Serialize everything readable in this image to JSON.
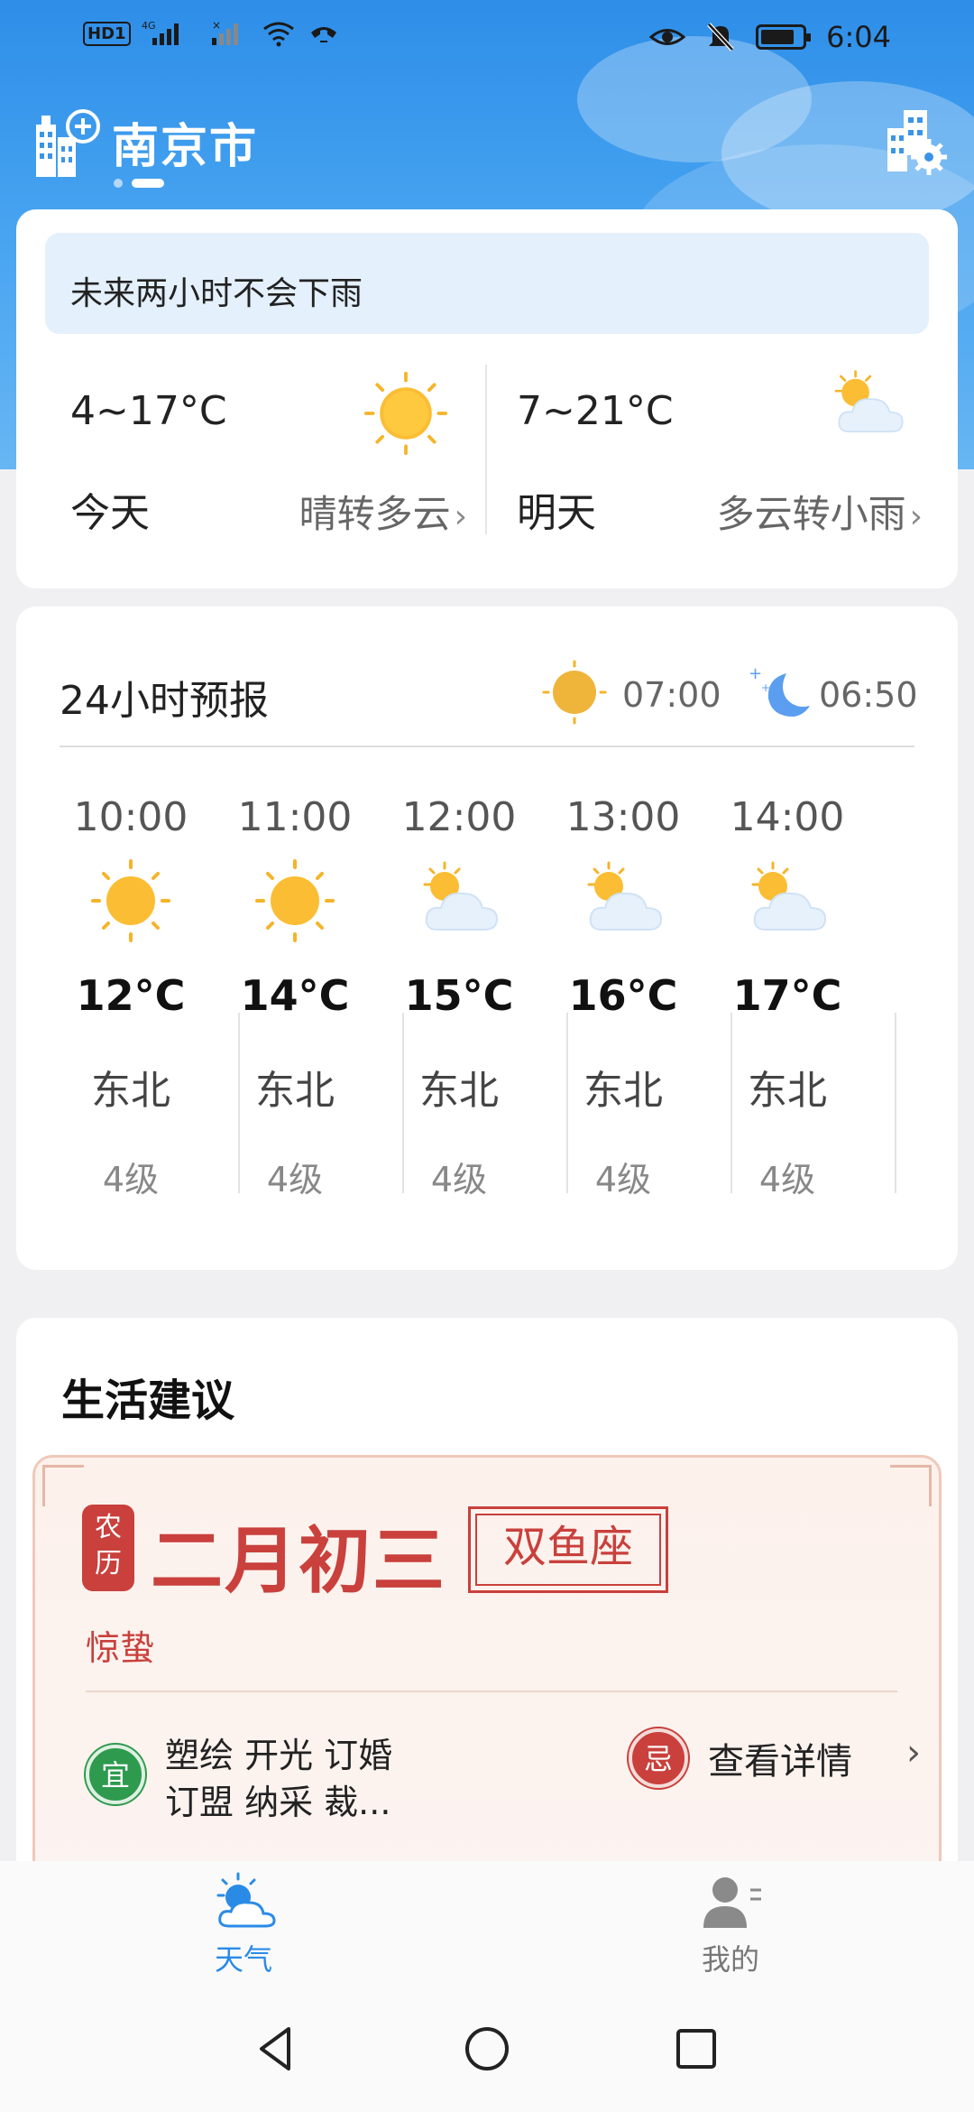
{
  "status_bar": {
    "network_label": "HD",
    "sim_label": "1",
    "signal_1_label": "4G",
    "time": "6:04"
  },
  "header": {
    "city": "南京市"
  },
  "nowcast": {
    "message": "未来两小时不会下雨"
  },
  "daily": [
    {
      "label": "今天",
      "range": "4~17°C",
      "condition": "晴转多云",
      "icon": "sun-icon"
    },
    {
      "label": "明天",
      "range": "7~21°C",
      "condition": "多云转小雨",
      "icon": "partly-cloudy-icon"
    }
  ],
  "hourly": {
    "title": "24小时预报",
    "sunrise": "07:00",
    "sunset": "06:50",
    "items": [
      {
        "time": "10:00",
        "icon": "sun-icon",
        "temp": "12°C",
        "wind_dir": "东北",
        "wind_level": "4级"
      },
      {
        "time": "11:00",
        "icon": "sun-icon",
        "temp": "14°C",
        "wind_dir": "东北",
        "wind_level": "4级"
      },
      {
        "time": "12:00",
        "icon": "partly-cloudy-icon",
        "temp": "15°C",
        "wind_dir": "东北",
        "wind_level": "4级"
      },
      {
        "time": "13:00",
        "icon": "partly-cloudy-icon",
        "temp": "16°C",
        "wind_dir": "东北",
        "wind_level": "4级"
      },
      {
        "time": "14:00",
        "icon": "partly-cloudy-icon",
        "temp": "17°C",
        "wind_dir": "东北",
        "wind_level": "4级"
      }
    ]
  },
  "life": {
    "title": "生活建议",
    "almanac": {
      "badge": "农历",
      "lunar_date": "二月初三",
      "zodiac": "双鱼座",
      "solar_term": "惊蛰",
      "yi_badge": "宜",
      "yi_line1": "塑绘 开光 订婚",
      "yi_line2": "订盟 纳采 裁...",
      "ji_badge": "忌",
      "detail_link": "查看详情"
    }
  },
  "bottom_nav": {
    "weather": "天气",
    "mine": "我的"
  },
  "colors": {
    "accent": "#2a8be6",
    "almanac_red": "#c9403c",
    "yi_green": "#2e9a4e"
  }
}
